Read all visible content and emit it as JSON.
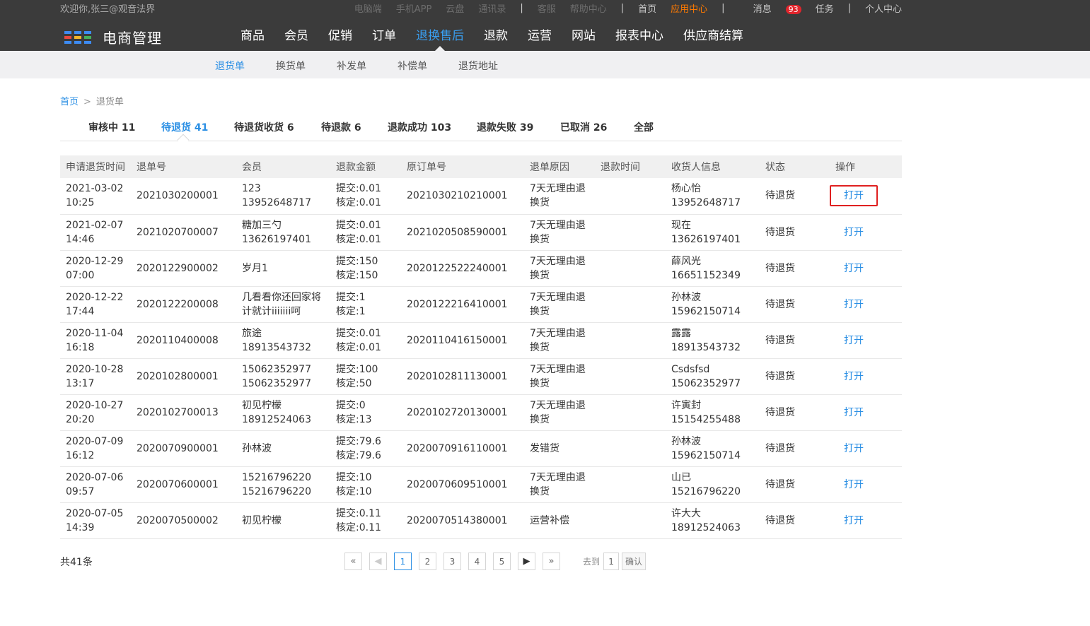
{
  "topbar": {
    "welcome": "欢迎你,张三@观音法界",
    "links": [
      "电脑端",
      "手机APP",
      "云盘",
      "通讯录",
      "客服",
      "帮助中心",
      "首页",
      "应用中心",
      "消息",
      "任务",
      "个人中心"
    ],
    "message_count": "93"
  },
  "header": {
    "app_title": "电商管理",
    "logo_colors": [
      "#3d8bf2",
      "#3d8bf2",
      "#3d8bf2",
      "#e8483f",
      "#f2b62b",
      "#46b05a",
      "#3d8bf2",
      "#3d8bf2",
      "#3d8bf2"
    ],
    "nav": [
      "商品",
      "会员",
      "促销",
      "订单",
      "退换售后",
      "退款",
      "运营",
      "网站",
      "报表中心",
      "供应商结算"
    ],
    "active_nav": "退换售后"
  },
  "subnav": [
    "退货单",
    "换货单",
    "补发单",
    "补偿单",
    "退货地址"
  ],
  "breadcrumb": {
    "home": "首页",
    "sep": ">",
    "current": "退货单"
  },
  "status_tabs": [
    "审核中 11",
    "待退货 41",
    "待退货收货 6",
    "待退款 6",
    "退款成功 103",
    "退款失败 39",
    "已取消 26",
    "全部"
  ],
  "table": {
    "headers": [
      "申请退货时间",
      "退单号",
      "会员",
      "退款金额",
      "原订单号",
      "退单原因",
      "退款时间",
      "收货人信息",
      "状态",
      "操作"
    ],
    "rows": [
      {
        "date": "2021-03-02",
        "time": "10:25",
        "no": "2021030200001",
        "member": [
          "123",
          "13952648717"
        ],
        "submit": "提交:0.01",
        "verify": "核定:0.01",
        "order": "2021030210210001",
        "reason": [
          "7天无理由退",
          "换货"
        ],
        "refund_time": "",
        "receiver": [
          "杨心怡",
          "13952648717"
        ],
        "status": "待退货",
        "op": "打开"
      },
      {
        "date": "2021-02-07",
        "time": "14:46",
        "no": "2021020700007",
        "member": [
          "糖加三勺",
          "13626197401"
        ],
        "submit": "提交:0.01",
        "verify": "核定:0.01",
        "order": "2021020508590001",
        "reason": [
          "7天无理由退",
          "换货"
        ],
        "refund_time": "",
        "receiver": [
          "现在",
          "13626197401"
        ],
        "status": "待退货",
        "op": "打开"
      },
      {
        "date": "2020-12-29",
        "time": "07:00",
        "no": "2020122900002",
        "member": [
          "岁月1",
          ""
        ],
        "submit": "提交:150",
        "verify": "核定:150",
        "order": "2020122522240001",
        "reason": [
          "7天无理由退",
          "换货"
        ],
        "refund_time": "",
        "receiver": [
          "薛风光",
          "16651152349"
        ],
        "status": "待退货",
        "op": "打开"
      },
      {
        "date": "2020-12-22",
        "time": "17:44",
        "no": "2020122200008",
        "member": [
          "几看看你还回家将",
          "计就计iiiiiii呵"
        ],
        "submit": "提交:1",
        "verify": "核定:1",
        "order": "2020122216410001",
        "reason": [
          "7天无理由退",
          "换货"
        ],
        "refund_time": "",
        "receiver": [
          "孙林波",
          "15962150714"
        ],
        "status": "待退货",
        "op": "打开"
      },
      {
        "date": "2020-11-04",
        "time": "16:18",
        "no": "2020110400008",
        "member": [
          "旅途",
          "18913543732"
        ],
        "submit": "提交:0.01",
        "verify": "核定:0.01",
        "order": "2020110416150001",
        "reason": [
          "7天无理由退",
          "换货"
        ],
        "refund_time": "",
        "receiver": [
          "露露",
          "18913543732"
        ],
        "status": "待退货",
        "op": "打开"
      },
      {
        "date": "2020-10-28",
        "time": "13:17",
        "no": "2020102800001",
        "member": [
          "15062352977",
          "15062352977"
        ],
        "submit": "提交:100",
        "verify": "核定:50",
        "order": "2020102811130001",
        "reason": [
          "7天无理由退",
          "换货"
        ],
        "refund_time": "",
        "receiver": [
          "Csdsfsd",
          "15062352977"
        ],
        "status": "待退货",
        "op": "打开"
      },
      {
        "date": "2020-10-27",
        "time": "20:20",
        "no": "2020102700013",
        "member": [
          "初见柠檬",
          "18912524063"
        ],
        "submit": "提交:0",
        "verify": "核定:13",
        "order": "2020102720130001",
        "reason": [
          "7天无理由退",
          "换货"
        ],
        "refund_time": "",
        "receiver": [
          "许寅封",
          "15154255488"
        ],
        "status": "待退货",
        "op": "打开"
      },
      {
        "date": "2020-07-09",
        "time": "16:12",
        "no": "2020070900001",
        "member": [
          "孙林波",
          ""
        ],
        "submit": "提交:79.6",
        "verify": "核定:79.6",
        "order": "2020070916110001",
        "reason": [
          "发错货",
          ""
        ],
        "refund_time": "",
        "receiver": [
          "孙林波",
          "15962150714"
        ],
        "status": "待退货",
        "op": "打开"
      },
      {
        "date": "2020-07-06",
        "time": "09:57",
        "no": "2020070600001",
        "member": [
          "15216796220",
          "15216796220"
        ],
        "submit": "提交:10",
        "verify": "核定:10",
        "order": "2020070609510001",
        "reason": [
          "7天无理由退",
          "换货"
        ],
        "refund_time": "",
        "receiver": [
          "山已",
          "15216796220"
        ],
        "status": "待退货",
        "op": "打开"
      },
      {
        "date": "2020-07-05",
        "time": "14:39",
        "no": "2020070500002",
        "member": [
          "初见柠檬",
          ""
        ],
        "submit": "提交:0.11",
        "verify": "核定:0.11",
        "order": "2020070514380001",
        "reason": [
          "运营补偿",
          ""
        ],
        "refund_time": "",
        "receiver": [
          "许大大",
          "18912524063"
        ],
        "status": "待退货",
        "op": "打开"
      }
    ]
  },
  "footer": {
    "total": "共41条",
    "pager": {
      "first": "«",
      "last": "»",
      "pages": [
        "1",
        "2",
        "3",
        "4",
        "5"
      ],
      "current_page": "1",
      "goto_label": "去到",
      "goto_value": "1",
      "confirm": "确认"
    }
  }
}
